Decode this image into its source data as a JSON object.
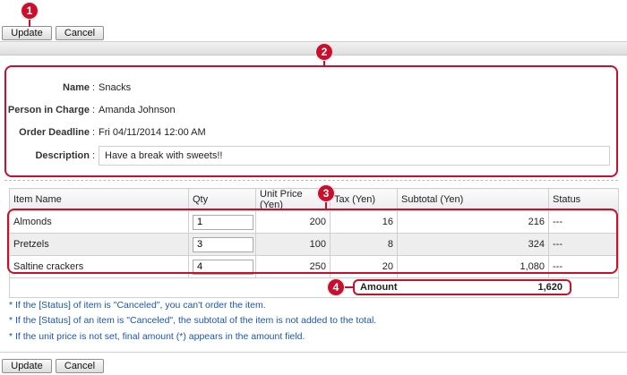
{
  "toolbar": {
    "update_label": "Update",
    "cancel_label": "Cancel"
  },
  "callouts": {
    "c1": "1",
    "c2": "2",
    "c3": "3",
    "c4": "4"
  },
  "details": {
    "name_label": "Name",
    "name_value": "Snacks",
    "person_label": "Person in Charge",
    "person_value": "Amanda Johnson",
    "deadline_label": "Order Deadline",
    "deadline_value": "Fri 04/11/2014 12:00 AM",
    "description_label": "Description",
    "description_value": "Have a break with sweets!!",
    "sep": ":"
  },
  "table": {
    "headers": [
      "Item Name",
      "Qty",
      "Unit Price (Yen)",
      "Tax (Yen)",
      "Subtotal (Yen)",
      "Status"
    ],
    "rows": [
      {
        "name": "Almonds",
        "qty": "1",
        "price": "200",
        "tax": "16",
        "subtotal": "216",
        "status": "---"
      },
      {
        "name": "Pretzels",
        "qty": "3",
        "price": "100",
        "tax": "8",
        "subtotal": "324",
        "status": "---"
      },
      {
        "name": "Saltine crackers",
        "qty": "4",
        "price": "250",
        "tax": "20",
        "subtotal": "1,080",
        "status": "---"
      }
    ]
  },
  "amount": {
    "label": "Amount",
    "value": "1,620"
  },
  "notes": [
    "* If the [Status] of item is \"Canceled\", you can't order the item.",
    "* If the [Status] of an item is \"Canceled\", the subtotal of the item is not added to the total.",
    "* If the unit price is not set, final amount (*) appears in the amount field."
  ],
  "colors": {
    "callout": "#c8102e",
    "note_text": "#1a56b0"
  }
}
